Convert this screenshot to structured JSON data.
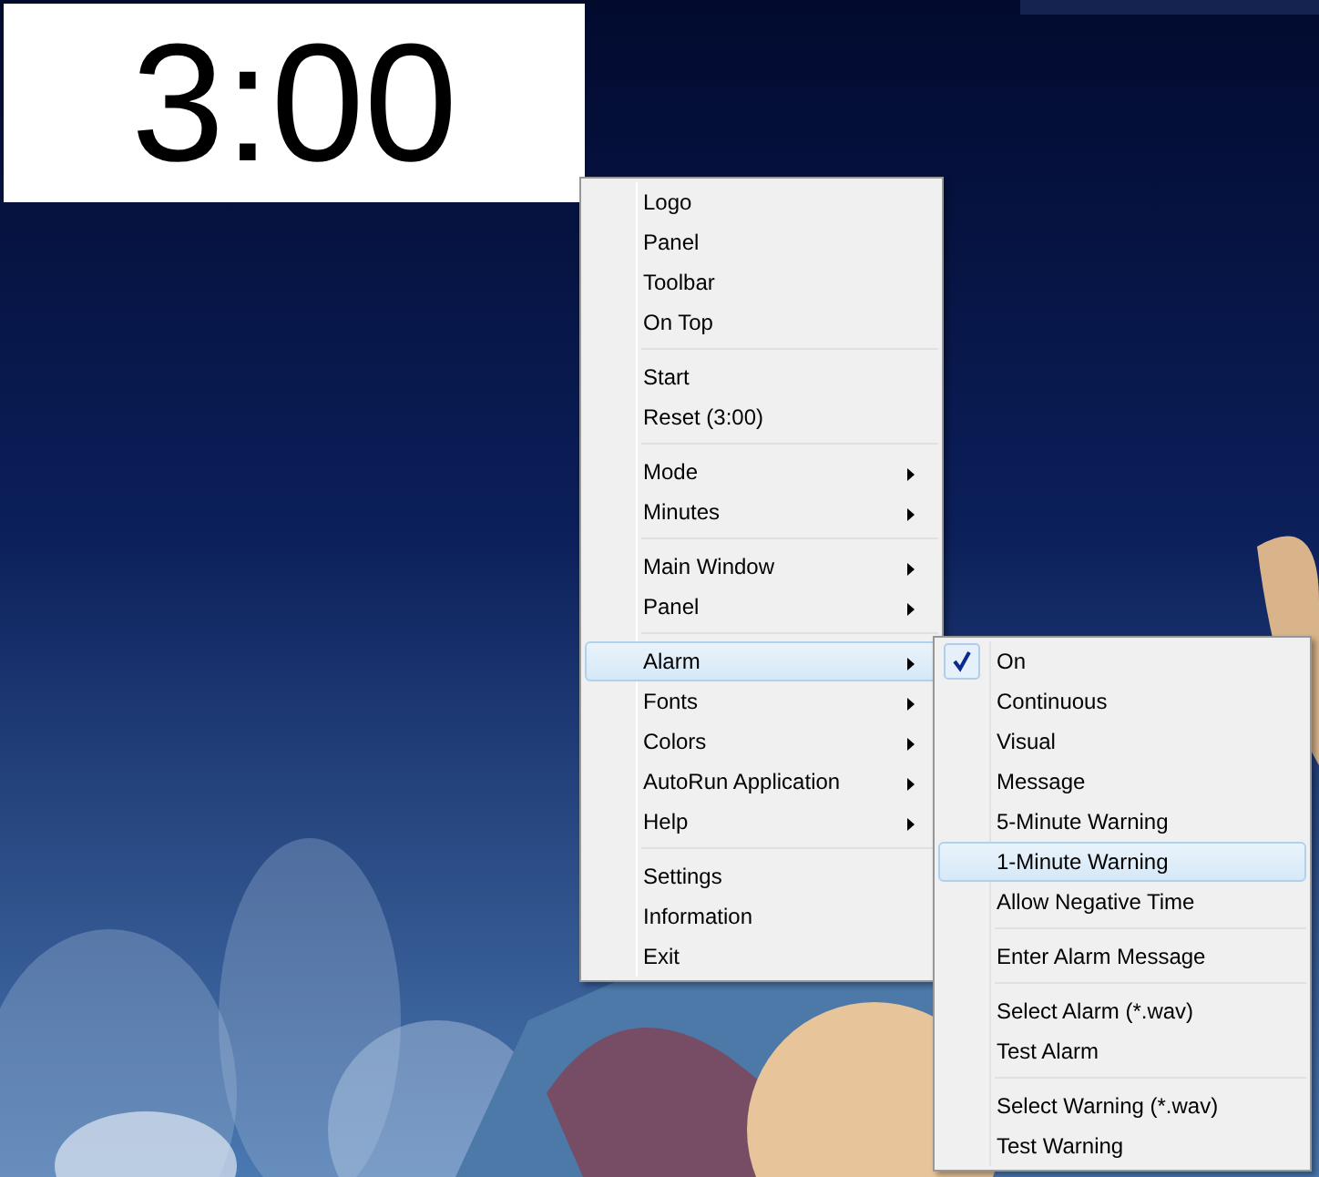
{
  "timer": {
    "display": "3:00"
  },
  "menu": {
    "groups": [
      [
        {
          "label": "Logo",
          "submenu": false,
          "selected": false
        },
        {
          "label": "Panel",
          "submenu": false,
          "selected": false
        },
        {
          "label": "Toolbar",
          "submenu": false,
          "selected": false
        },
        {
          "label": "On Top",
          "submenu": false,
          "selected": false
        }
      ],
      [
        {
          "label": "Start",
          "submenu": false,
          "selected": false
        },
        {
          "label": "Reset (3:00)",
          "submenu": false,
          "selected": false
        }
      ],
      [
        {
          "label": "Mode",
          "submenu": true,
          "selected": false
        },
        {
          "label": "Minutes",
          "submenu": true,
          "selected": false
        }
      ],
      [
        {
          "label": "Main Window",
          "submenu": true,
          "selected": false
        },
        {
          "label": "Panel",
          "submenu": true,
          "selected": false
        }
      ],
      [
        {
          "label": "Alarm",
          "submenu": true,
          "selected": true
        },
        {
          "label": "Fonts",
          "submenu": true,
          "selected": false
        },
        {
          "label": "Colors",
          "submenu": true,
          "selected": false
        },
        {
          "label": "AutoRun Application",
          "submenu": true,
          "selected": false
        },
        {
          "label": "Help",
          "submenu": true,
          "selected": false
        }
      ],
      [
        {
          "label": "Settings",
          "submenu": false,
          "selected": false
        },
        {
          "label": "Information",
          "submenu": false,
          "selected": false
        },
        {
          "label": "Exit",
          "submenu": false,
          "selected": false
        }
      ]
    ]
  },
  "alarm_submenu": {
    "groups": [
      [
        {
          "label": "On",
          "checked": true,
          "selected": false
        },
        {
          "label": "Continuous",
          "checked": false,
          "selected": false
        },
        {
          "label": "Visual",
          "checked": false,
          "selected": false
        },
        {
          "label": "Message",
          "checked": false,
          "selected": false
        },
        {
          "label": "5-Minute Warning",
          "checked": false,
          "selected": false
        },
        {
          "label": "1-Minute Warning",
          "checked": false,
          "selected": true
        },
        {
          "label": "Allow Negative Time",
          "checked": false,
          "selected": false
        }
      ],
      [
        {
          "label": "Enter Alarm Message",
          "checked": false,
          "selected": false
        }
      ],
      [
        {
          "label": "Select Alarm (*.wav)",
          "checked": false,
          "selected": false
        },
        {
          "label": "Test Alarm",
          "checked": false,
          "selected": false
        }
      ],
      [
        {
          "label": "Select Warning (*.wav)",
          "checked": false,
          "selected": false
        },
        {
          "label": "Test Warning",
          "checked": false,
          "selected": false
        }
      ]
    ]
  }
}
